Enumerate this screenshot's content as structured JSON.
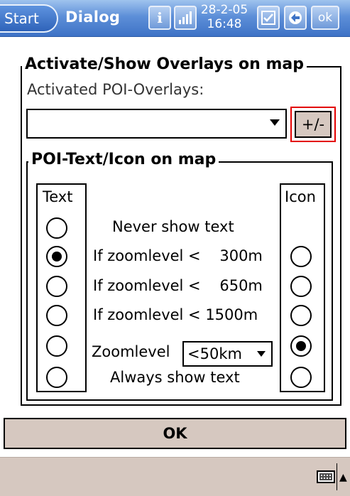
{
  "titlebar": {
    "start_label": "Start",
    "title": "Dialog",
    "clock_date": "28-2-05",
    "clock_time": "16:48",
    "ok_label": "ok"
  },
  "overlays": {
    "group_title": "Activate/Show Overlays on map",
    "activated_label": "Activated POI-Overlays:",
    "combo_value": "",
    "plusminus_label": "+/-"
  },
  "poi": {
    "group_title": "POI-Text/Icon on map",
    "text_header": "Text",
    "icon_header": "Icon",
    "rows": [
      {
        "label": "Never show text",
        "text_selected": false,
        "icon_selected": null
      },
      {
        "label": "If zoomlevel <   300m",
        "text_selected": true,
        "icon_selected": false
      },
      {
        "label": "If zoomlevel <   650m",
        "text_selected": false,
        "icon_selected": false
      },
      {
        "label": "If zoomlevel < 1500m",
        "text_selected": false,
        "icon_selected": false
      },
      {
        "label": "Zoomlevel",
        "text_selected": false,
        "icon_selected": true
      },
      {
        "label": "Always show text",
        "text_selected": false,
        "icon_selected": false
      }
    ],
    "zoom_select_value": "<50km"
  },
  "footer": {
    "ok_button": "OK"
  }
}
